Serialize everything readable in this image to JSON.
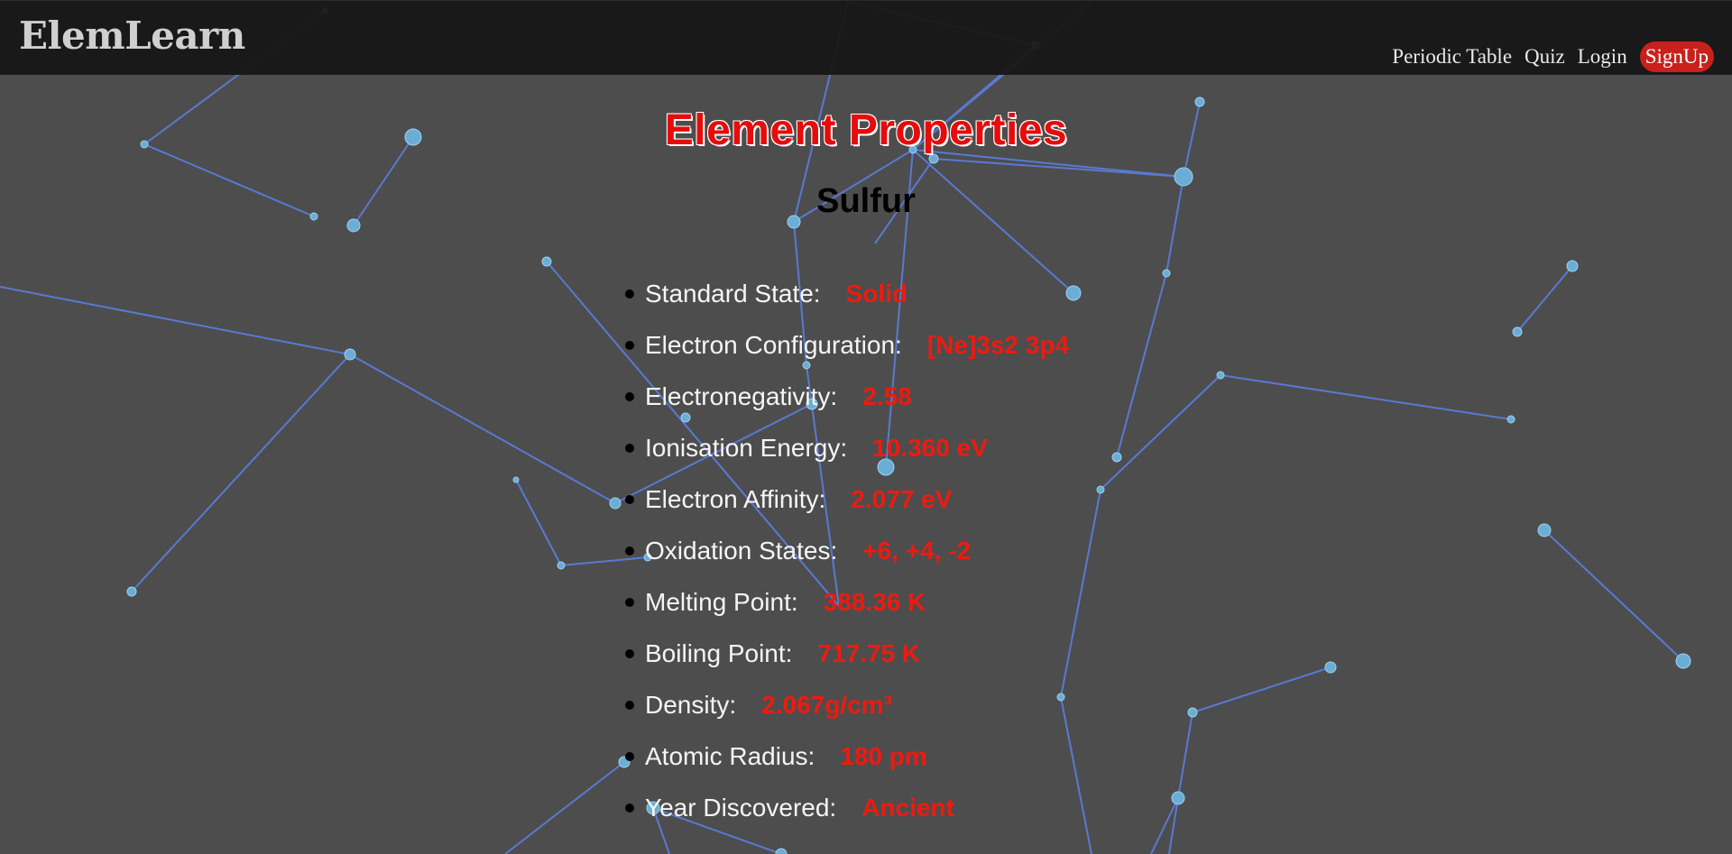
{
  "app": {
    "brand": "ElemLearn"
  },
  "nav": {
    "items": [
      {
        "label": "Periodic Table"
      },
      {
        "label": "Quiz"
      },
      {
        "label": "Login"
      },
      {
        "label": "SignUp"
      }
    ]
  },
  "page": {
    "title": "Element Properties",
    "element_name": "Sulfur"
  },
  "properties": [
    {
      "label": "Standard State:",
      "value": "Solid"
    },
    {
      "label": "Electron Configuration:",
      "value": "[Ne]3s2 3p4"
    },
    {
      "label": "Electronegativity:",
      "value": "2.58"
    },
    {
      "label": "Ionisation Energy:",
      "value": "10.360 eV"
    },
    {
      "label": "Electron Affinity:",
      "value": "2.077 eV"
    },
    {
      "label": "Oxidation States:",
      "value": "+6, +4, -2"
    },
    {
      "label": "Melting Point:",
      "value": "388.36 K"
    },
    {
      "label": "Boiling Point:",
      "value": "717.75 K"
    },
    {
      "label": "Density:",
      "value": "2.067g/cm³"
    },
    {
      "label": "Atomic Radius:",
      "value": "180 pm"
    },
    {
      "label": "Year Discovered:",
      "value": "Ancient"
    }
  ],
  "colors": {
    "accent": "#e80b0b",
    "value_red": "#ee1a0f",
    "signup_bg": "#c8211c",
    "navbar_bg": "#161616",
    "page_bg": "#4d4d4d",
    "network_line": "#5b7ee0",
    "network_node": "#6aaed6"
  }
}
